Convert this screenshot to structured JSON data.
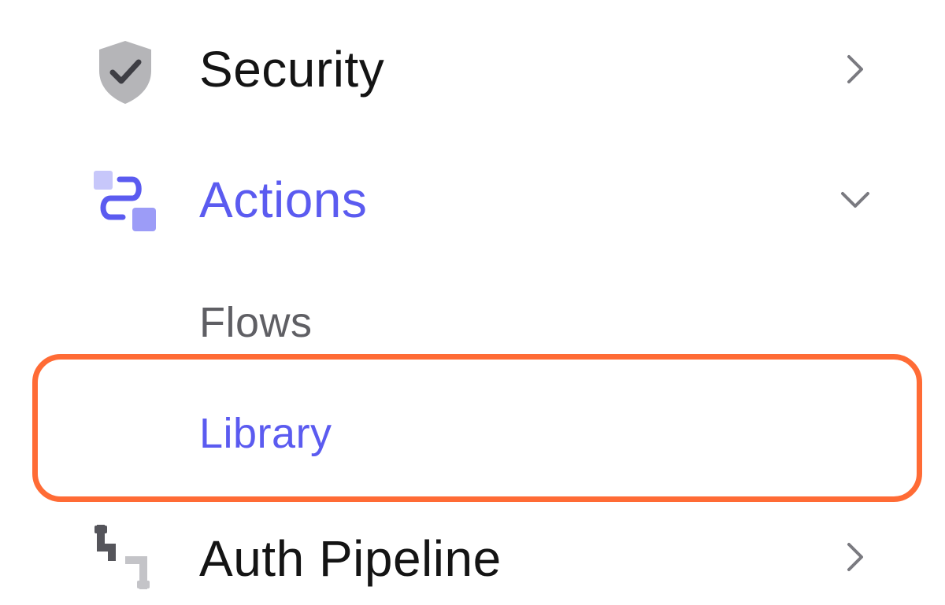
{
  "colors": {
    "accent": "#5B5BF0",
    "text_dark": "#141414",
    "text_muted": "#5F5F64",
    "icon_gray": "#B5B5B8",
    "chevron": "#7A7A80",
    "highlight": "#FF6B35"
  },
  "nav": {
    "items": [
      {
        "label": "Security",
        "icon": "shield-check-icon",
        "chevron": "chevron-right-icon"
      },
      {
        "label": "Actions",
        "icon": "actions-flow-icon",
        "chevron": "chevron-down-icon",
        "children": [
          {
            "label": "Flows"
          },
          {
            "label": "Library"
          }
        ]
      },
      {
        "label": "Auth Pipeline",
        "icon": "pipeline-icon",
        "chevron": "chevron-right-icon"
      }
    ]
  }
}
